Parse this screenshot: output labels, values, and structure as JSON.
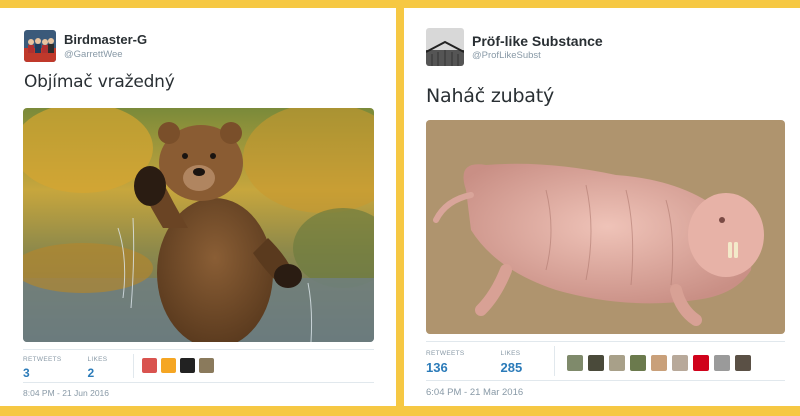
{
  "tweets": [
    {
      "display_name": "Birdmaster-G",
      "handle": "@GarrettWee",
      "text": "Objímač vražedný",
      "photo_subject": "brown bear standing and waving",
      "stats": {
        "retweets_label": "RETWEETS",
        "retweets": "3",
        "likes_label": "LIKES",
        "likes": "2"
      },
      "liker_avatars": [
        "#d9534f",
        "#f5a623",
        "#222222",
        "#8a7a5c"
      ],
      "timestamp": "8:04 PM - 21 Jun 2016"
    },
    {
      "display_name": "Pröf-like Substance",
      "handle": "@ProfLikeSubst",
      "text": "Naháč zubatý",
      "photo_subject": "naked mole rat",
      "stats": {
        "retweets_label": "RETWEETS",
        "retweets": "136",
        "likes_label": "LIKES",
        "likes": "285"
      },
      "liker_avatars": [
        "#7f8a6b",
        "#4a4a3a",
        "#a8a089",
        "#6b7a4d",
        "#c9a07a",
        "#b8a99a",
        "#d0021b",
        "#9a9a9a",
        "#5a5045"
      ],
      "timestamp": "6:04 PM - 21 Mar 2016"
    }
  ]
}
